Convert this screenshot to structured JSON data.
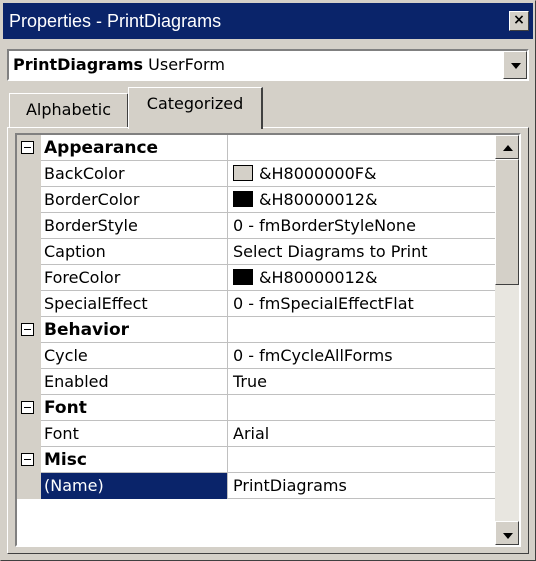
{
  "window": {
    "title": "Properties - PrintDiagrams",
    "close_glyph": "×"
  },
  "object_selector": {
    "name": "PrintDiagrams",
    "type": "UserForm"
  },
  "tabs": [
    {
      "label": "Alphabetic",
      "active": false
    },
    {
      "label": "Categorized",
      "active": true
    }
  ],
  "colors": {
    "titlebar": "#0a246a",
    "selection": "#0a246a",
    "face": "#d4d0c8"
  },
  "categories": [
    {
      "name": "Appearance",
      "expanded": true,
      "props": [
        {
          "name": "BackColor",
          "value": "&H8000000F&",
          "swatch": "#d4d0c8"
        },
        {
          "name": "BorderColor",
          "value": "&H80000012&",
          "swatch": "#000000"
        },
        {
          "name": "BorderStyle",
          "value": "0 - fmBorderStyleNone"
        },
        {
          "name": "Caption",
          "value": "Select Diagrams to Print"
        },
        {
          "name": "ForeColor",
          "value": "&H80000012&",
          "swatch": "#000000"
        },
        {
          "name": "SpecialEffect",
          "value": "0 - fmSpecialEffectFlat"
        }
      ]
    },
    {
      "name": "Behavior",
      "expanded": true,
      "props": [
        {
          "name": "Cycle",
          "value": "0 - fmCycleAllForms"
        },
        {
          "name": "Enabled",
          "value": "True"
        }
      ]
    },
    {
      "name": "Font",
      "expanded": true,
      "props": [
        {
          "name": "Font",
          "value": "Arial"
        }
      ]
    },
    {
      "name": "Misc",
      "expanded": true,
      "props": [
        {
          "name": "(Name)",
          "value": "PrintDiagrams",
          "selected": true
        }
      ]
    }
  ]
}
